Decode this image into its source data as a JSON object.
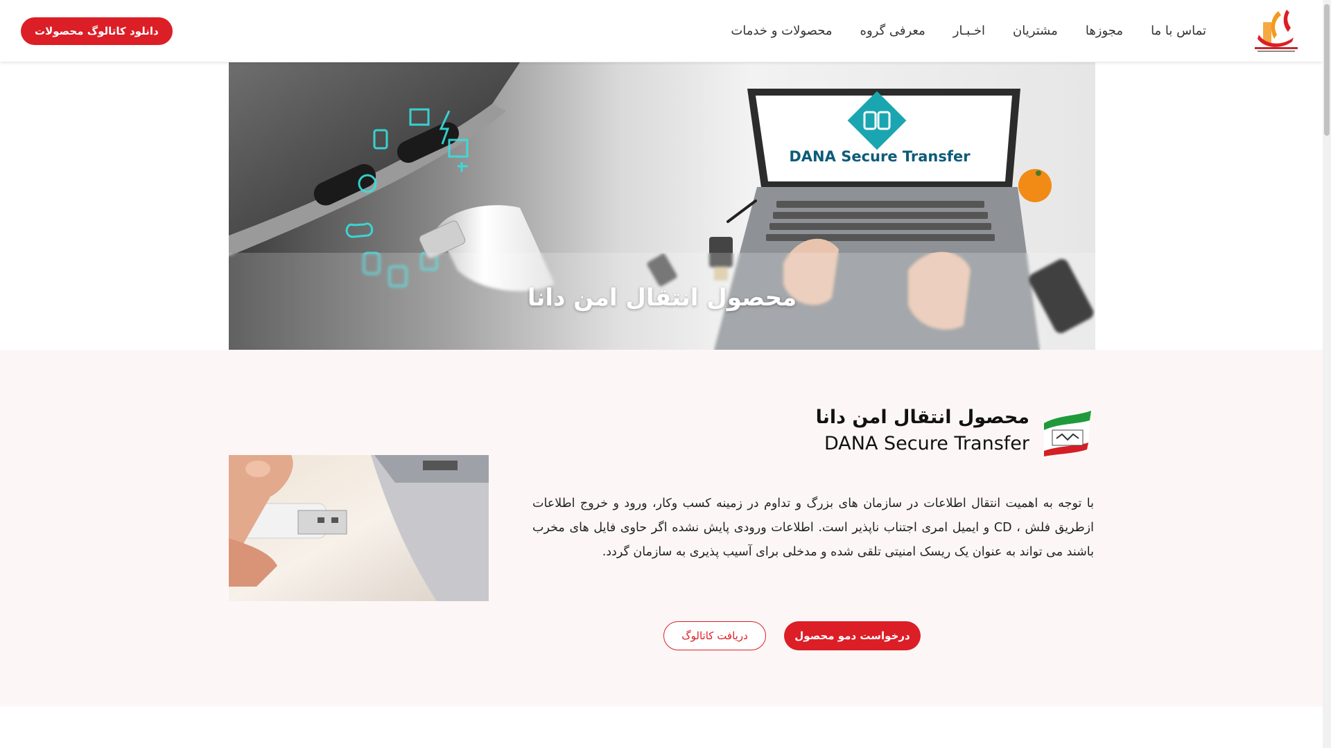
{
  "header": {
    "logo_icon": "company-logo",
    "nav": [
      "محصولات و خدمات",
      "معرفی گروه",
      "اخـبـار",
      "مشتریان",
      "مجوزها",
      "تماس با ما"
    ],
    "catalog_button": "دانلود کاتالوگ محصولات"
  },
  "hero": {
    "title": "محصول انتقال امن دانا",
    "screen_text": "DANA Secure Transfer",
    "screen_text_highlight_color": "#f2a21e",
    "screen_logo_icon": "dana-diamond-logo"
  },
  "product": {
    "badge_icon": "made-in-iran-badge",
    "title_fa": "محصول انتقال امن دانا",
    "title_en": "DANA Secure Transfer",
    "description": "با توجه به اهمیت انتقال اطلاعات در سازمان های بزرگ و تداوم در زمینه کسب وکار، ورود و خروج اطلاعات ازطریق فلش ، CD و ایمیل امری اجتناب ناپذیر است. اطلاعات ورودی پایش نشده اگر حاوی فایل های مخرب باشند می تواند به عنوان یک ریسک امنیتی تلقی شده و مدخلی برای آسیب پذیری به سازمان گردد.",
    "demo_button": "درخواست دمو محصول",
    "catalog_button": "دریافت کاتالوگ",
    "image_icon": "usb-flash-drive-photo"
  },
  "colors": {
    "brand_red": "#dc1e27",
    "section_bg": "#fcf7f6"
  }
}
